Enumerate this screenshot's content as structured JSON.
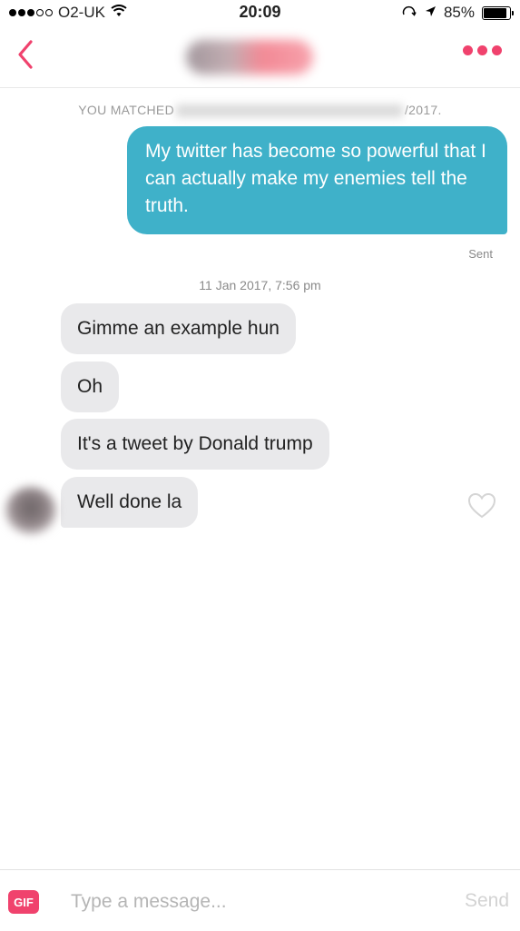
{
  "status_bar": {
    "carrier": "O2-UK",
    "time": "20:09",
    "battery": "85%"
  },
  "nav": {
    "back_icon": "chevron-left-icon",
    "more_icon": "more-dots-icon",
    "accent_color": "#f0426d"
  },
  "chat": {
    "matched_prefix": "YOU MATCHED",
    "matched_suffix": "/2017.",
    "outgoing": [
      {
        "text": "My twitter has become so powerful that I can actually make my enemies tell the truth.",
        "status": "Sent"
      }
    ],
    "timestamp": "11 Jan 2017, 7:56 pm",
    "incoming": [
      {
        "text": "Gimme an example hun"
      },
      {
        "text": "Oh"
      },
      {
        "text": "It's a tweet by Donald trump"
      },
      {
        "text": "Well done la"
      }
    ],
    "outgoing_bubble_color": "#3fb1c9",
    "incoming_bubble_color": "#e9e9eb"
  },
  "composer": {
    "gif_label": "GIF",
    "placeholder": "Type a message...",
    "send_label": "Send"
  }
}
